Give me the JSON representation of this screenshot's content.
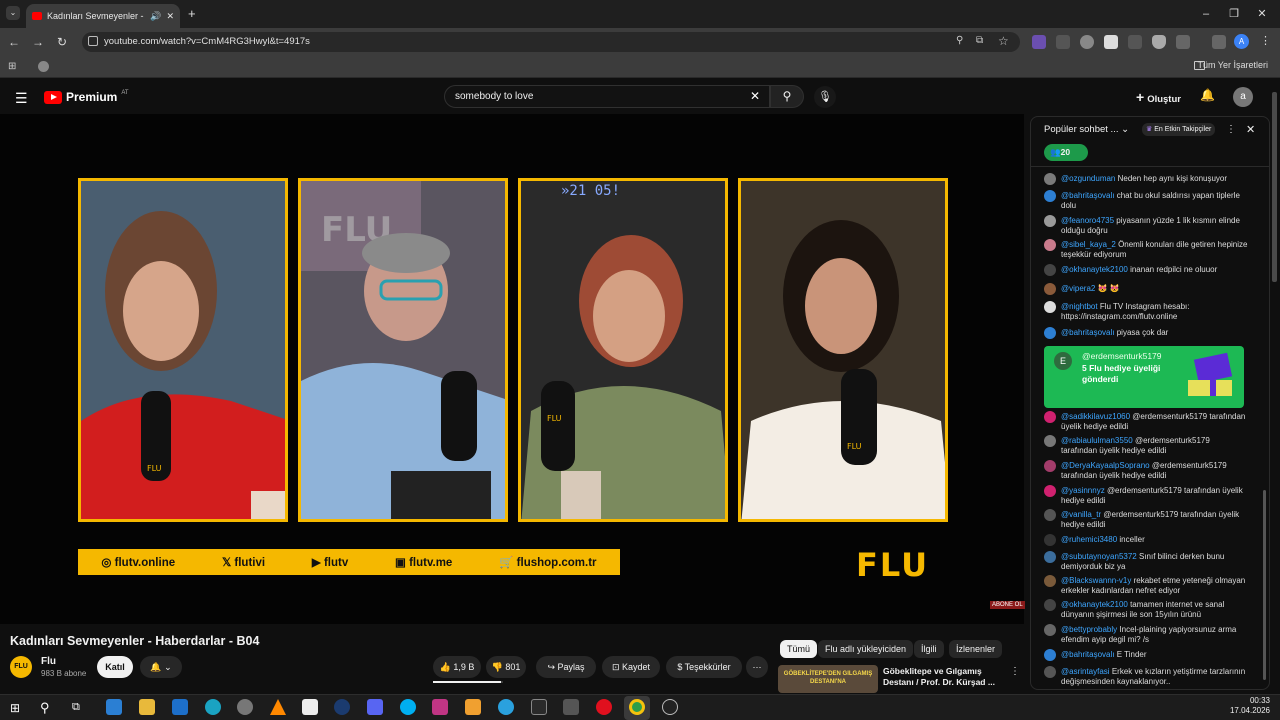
{
  "browser": {
    "tab_title": "Kadınları Sevmeyenler - Ha",
    "url": "youtube.com/watch?v=CmM4RG3Hwyl&t=4917s",
    "bookmarks_label": "Tüm Yer İşaretleri"
  },
  "youtube": {
    "logo_text": "Premium",
    "logo_region": "AT",
    "search_value": "somebody to love",
    "create_label": "Oluştur",
    "avatar_letter": "a"
  },
  "video": {
    "social_links": [
      "flutv.online",
      "flutivi",
      "flutv",
      "flutv.me",
      "flushop.com.tr"
    ],
    "logo": "FLU",
    "abone_badge": "ABONE OL",
    "title": "Kadınları Sevmeyenler - Haberdarlar - B04",
    "channel": "Flu",
    "subscribers": "983 B abone",
    "join_label": "Katıl",
    "likes": "1,9 B",
    "dislikes": "801",
    "share_label": "Paylaş",
    "save_label": "Kaydet",
    "thanks_label": "Teşekkürler"
  },
  "recommend": {
    "chips": [
      "Tümü",
      "Flu adlı yükleyiciden",
      "İlgili",
      "İzlenenler"
    ],
    "item_title": "Göbeklitepe ve Gılgamış Destanı / Prof. Dr. Kürşad ...",
    "thumb_text": "GÖBEKLİTEPE'DEN GILGAMIŞ DESTANI'NA"
  },
  "chat": {
    "header": "Popüler sohbet ...",
    "top_supporters": "En Etkin Takipçiler",
    "viewer_count": "20",
    "messages": [
      {
        "user": "@ozgunduman",
        "text": "Neden hep aynı kişi konuşuyor",
        "color": "#7a7a7a"
      },
      {
        "user": "@bahritaşovalı",
        "text": "chat bu okul saldırısı yapan tiplerle dolu",
        "color": "#2d7fd3"
      },
      {
        "user": "@feanoro4735",
        "text": "piyasanın yüzde 1 lik kısmın elinde olduğu doğru",
        "color": "#9a9a9a"
      },
      {
        "user": "@sibel_kaya_2",
        "text": "Önemli konuları dile getiren hepinize teşekkür ediyorum",
        "color": "#c97b8c"
      },
      {
        "user": "@okhanaytek2100",
        "text": "inanan redpilci ne oluuor",
        "color": "#444"
      },
      {
        "user": "@vipera2",
        "text": "😻 😻",
        "color": "#8a5a3a"
      },
      {
        "user": "@nightbot",
        "text": "Flu TV Instagram hesabı: https://instagram.com/flutv.online",
        "color": "#ddd"
      },
      {
        "user": "@bahritaşovalı",
        "text": "piyasa çok dar",
        "color": "#2d7fd3"
      },
      {
        "user": "@sadikkilavuz1060",
        "text": "@erdemsenturk5179 tarafından üyelik hediye edildi",
        "color": "#d0216f"
      },
      {
        "user": "@rabiaululman3550",
        "text": "@erdemsenturk5179 tarafından üyelik hediye edildi",
        "color": "#777"
      },
      {
        "user": "@DeryaKayaalpSoprano",
        "text": "@erdemsenturk5179 tarafından üyelik hediye edildi",
        "color": "#a33c6a"
      },
      {
        "user": "@yasinnnyz",
        "text": "@erdemsenturk5179 tarafından üyelik hediye edildi",
        "color": "#d0216f"
      },
      {
        "user": "@vanilla_tr",
        "text": "@erdemsenturk5179 tarafından üyelik hediye edildi",
        "color": "#555"
      },
      {
        "user": "@ruhemici3480",
        "text": "inceller",
        "color": "#333"
      },
      {
        "user": "@subutaynoyan5372",
        "text": "Sınıf bilinci derken bunu demiyorduk biz ya",
        "color": "#3b6d9c"
      },
      {
        "user": "@Blackswannn-v1y",
        "text": "rekabet etme yeteneği olmayan erkekler kadınlardan nefret ediyor",
        "color": "#7a5a3a"
      },
      {
        "user": "@okhanaytek2100",
        "text": "tamamen internet ve sanal dünyanın şişirmesi ile son 15yılın ürünü",
        "color": "#444"
      },
      {
        "user": "@bettyprobably",
        "text": "Incel-plaining yapiyorsunuz arma efendim ayip degil mi? /s",
        "color": "#666"
      },
      {
        "user": "@bahritaşovalı",
        "text": "E Tinder",
        "color": "#2d7fd3"
      },
      {
        "user": "@asrintayfasi",
        "text": "Erkek ve kızların yetiştirme tarzlarının değişmesinden kaynaklanıyor..",
        "color": "#555"
      }
    ],
    "gift": {
      "avatar": "E",
      "user": "@erdemsenturk5179",
      "text": "5 Flu hediye üyeliği gönderdi"
    }
  },
  "taskbar": {
    "time": "00:33",
    "date": "17.04.2026"
  }
}
